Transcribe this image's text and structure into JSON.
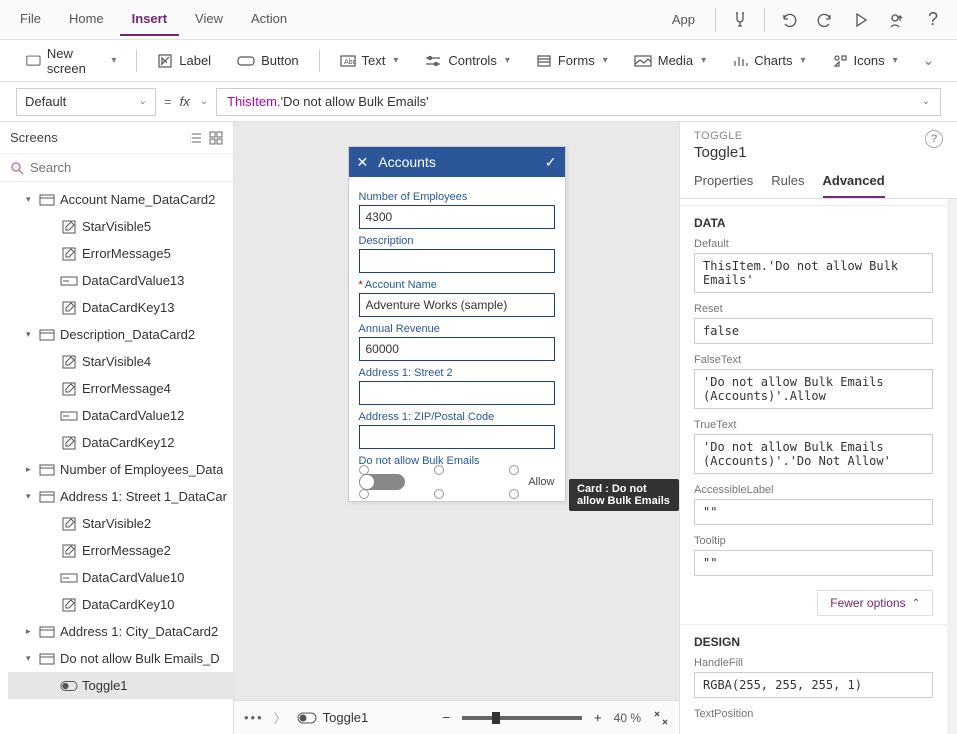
{
  "menu": {
    "file": "File",
    "home": "Home",
    "insert": "Insert",
    "view": "View",
    "action": "Action",
    "app": "App"
  },
  "ribbon": {
    "newscreen": "New screen",
    "label": "Label",
    "button": "Button",
    "text": "Text",
    "controls": "Controls",
    "forms": "Forms",
    "media": "Media",
    "charts": "Charts",
    "icons": "Icons"
  },
  "fbar": {
    "property": "Default",
    "fx": "fx",
    "tok1": "ThisItem.",
    "tok2": "'Do not allow Bulk Emails'"
  },
  "left": {
    "title": "Screens",
    "search_ph": "Search",
    "items": [
      {
        "lvl": 1,
        "tri": "▾",
        "icon": "card",
        "label": "Account Name_DataCard2"
      },
      {
        "lvl": 2,
        "icon": "pen",
        "label": "StarVisible5"
      },
      {
        "lvl": 2,
        "icon": "pen",
        "label": "ErrorMessage5"
      },
      {
        "lvl": 2,
        "icon": "input",
        "label": "DataCardValue13"
      },
      {
        "lvl": 2,
        "icon": "pen",
        "label": "DataCardKey13"
      },
      {
        "lvl": 1,
        "tri": "▾",
        "icon": "card",
        "label": "Description_DataCard2"
      },
      {
        "lvl": 2,
        "icon": "pen",
        "label": "StarVisible4"
      },
      {
        "lvl": 2,
        "icon": "pen",
        "label": "ErrorMessage4"
      },
      {
        "lvl": 2,
        "icon": "input",
        "label": "DataCardValue12"
      },
      {
        "lvl": 2,
        "icon": "pen",
        "label": "DataCardKey12"
      },
      {
        "lvl": 1,
        "tri": "▸",
        "icon": "card",
        "label": "Number of Employees_Data"
      },
      {
        "lvl": 1,
        "tri": "▾",
        "icon": "card",
        "label": "Address 1: Street 1_DataCar"
      },
      {
        "lvl": 2,
        "icon": "pen",
        "label": "StarVisible2"
      },
      {
        "lvl": 2,
        "icon": "pen",
        "label": "ErrorMessage2"
      },
      {
        "lvl": 2,
        "icon": "input",
        "label": "DataCardValue10"
      },
      {
        "lvl": 2,
        "icon": "pen",
        "label": "DataCardKey10"
      },
      {
        "lvl": 1,
        "tri": "▸",
        "icon": "card",
        "label": "Address 1: City_DataCard2"
      },
      {
        "lvl": 1,
        "tri": "▾",
        "icon": "card",
        "label": "Do not allow Bulk Emails_D"
      },
      {
        "lvl": 2,
        "icon": "toggle",
        "label": "Toggle1",
        "selected": true
      }
    ]
  },
  "canvas": {
    "title": "Accounts",
    "fields": [
      {
        "label": "Number of Employees",
        "value": "4300"
      },
      {
        "label": "Description",
        "value": ""
      },
      {
        "label": "Account Name",
        "value": "Adventure Works (sample)",
        "required": true
      },
      {
        "label": "Annual Revenue",
        "value": "60000"
      },
      {
        "label": "Address 1: Street 2",
        "value": ""
      },
      {
        "label": "Address 1: ZIP/Postal Code",
        "value": ""
      }
    ],
    "toggle_label": "Do not allow Bulk Emails",
    "toggle_text": "Allow",
    "tooltip": "Card : Do not allow Bulk Emails"
  },
  "breadcrumb": {
    "item": "Toggle1",
    "zoom": "40  %"
  },
  "right": {
    "kind": "TOGGLE",
    "name": "Toggle1",
    "tabs": {
      "properties": "Properties",
      "rules": "Rules",
      "advanced": "Advanced"
    },
    "sections": {
      "data": "DATA",
      "props": [
        {
          "label": "Default",
          "value": "ThisItem.'Do not allow Bulk Emails'"
        },
        {
          "label": "Reset",
          "value": "false"
        },
        {
          "label": "FalseText",
          "value": "'Do not allow Bulk Emails (Accounts)'.Allow"
        },
        {
          "label": "TrueText",
          "value": "'Do not allow Bulk Emails (Accounts)'.'Do Not Allow'"
        },
        {
          "label": "AccessibleLabel",
          "value": "\"\""
        },
        {
          "label": "Tooltip",
          "value": "\"\""
        }
      ],
      "fewer": "Fewer options",
      "design": "DESIGN",
      "design_props": [
        {
          "label": "HandleFill",
          "value": "RGBA(255, 255, 255, 1)"
        },
        {
          "label": "TextPosition",
          "value": ""
        }
      ]
    }
  }
}
